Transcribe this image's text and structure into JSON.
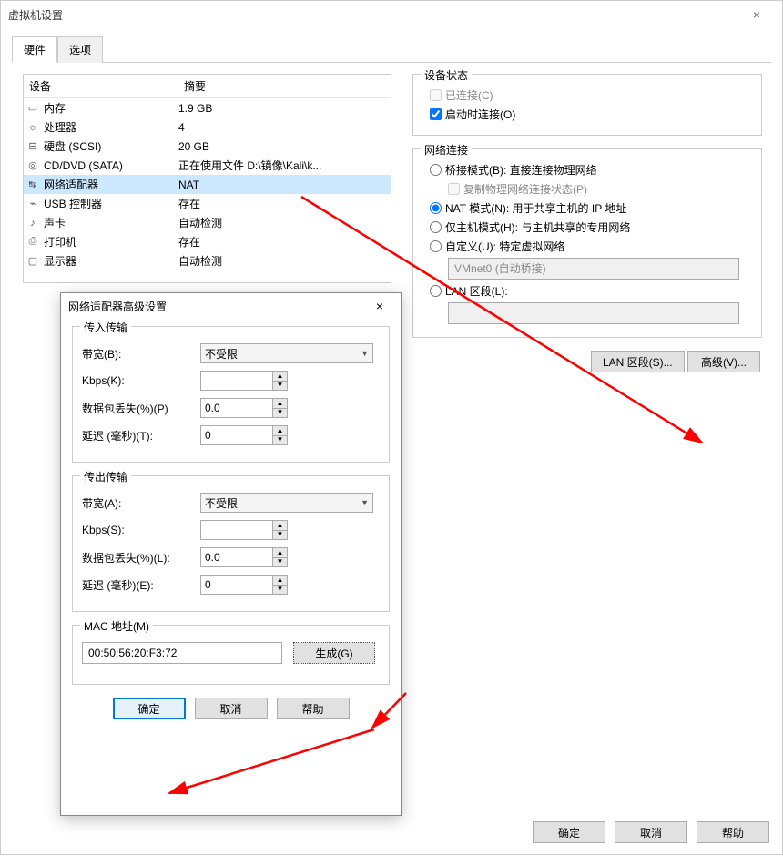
{
  "window": {
    "title": "虚拟机设置",
    "close": "×"
  },
  "tabs": {
    "hardware": "硬件",
    "options": "选项"
  },
  "devlist": {
    "header_device": "设备",
    "header_summary": "摘要",
    "rows": [
      {
        "name": "内存",
        "summary": "1.9 GB"
      },
      {
        "name": "处理器",
        "summary": "4"
      },
      {
        "name": "硬盘 (SCSI)",
        "summary": "20 GB"
      },
      {
        "name": "CD/DVD (SATA)",
        "summary": "正在使用文件 D:\\镜像\\Kali\\k..."
      },
      {
        "name": "网络适配器",
        "summary": "NAT"
      },
      {
        "name": "USB 控制器",
        "summary": "存在"
      },
      {
        "name": "声卡",
        "summary": "自动检测"
      },
      {
        "name": "打印机",
        "summary": "存在"
      },
      {
        "name": "显示器",
        "summary": "自动检测"
      }
    ]
  },
  "status": {
    "legend": "设备状态",
    "connected": "已连接(C)",
    "connect_on_power": "启动时连接(O)"
  },
  "net": {
    "legend": "网络连接",
    "bridged": "桥接模式(B): 直接连接物理网络",
    "replicate": "复制物理网络连接状态(P)",
    "nat": "NAT 模式(N): 用于共享主机的 IP 地址",
    "hostonly": "仅主机模式(H): 与主机共享的专用网络",
    "custom": "自定义(U): 特定虚拟网络",
    "vmnet": "VMnet0 (自动桥接)",
    "lanseg": "LAN 区段(L):",
    "btn_lanseg": "LAN 区段(S)...",
    "btn_adv": "高级(V)..."
  },
  "adv": {
    "title": "网络适配器高级设置",
    "close": "×",
    "incoming_legend": "传入传输",
    "outgoing_legend": "传出传输",
    "bandwidth_b": "带宽(B):",
    "bandwidth_a": "带宽(A):",
    "unlimited": "不受限",
    "kbps_k": "Kbps(K):",
    "kbps_s": "Kbps(S):",
    "loss_p": "数据包丢失(%)(P)",
    "loss_l": "数据包丢失(%)(L):",
    "latency_t": "延迟 (毫秒)(T):",
    "latency_e": "延迟 (毫秒)(E):",
    "kbps_val": "",
    "loss_val": "0.0",
    "lat_val": "0",
    "mac_legend": "MAC 地址(M)",
    "mac_value": "00:50:56:20:F3:72",
    "generate": "生成(G)",
    "ok": "确定",
    "cancel": "取消",
    "help": "帮助"
  },
  "bottom": {
    "ok": "确定",
    "cancel": "取消",
    "help": "帮助"
  }
}
